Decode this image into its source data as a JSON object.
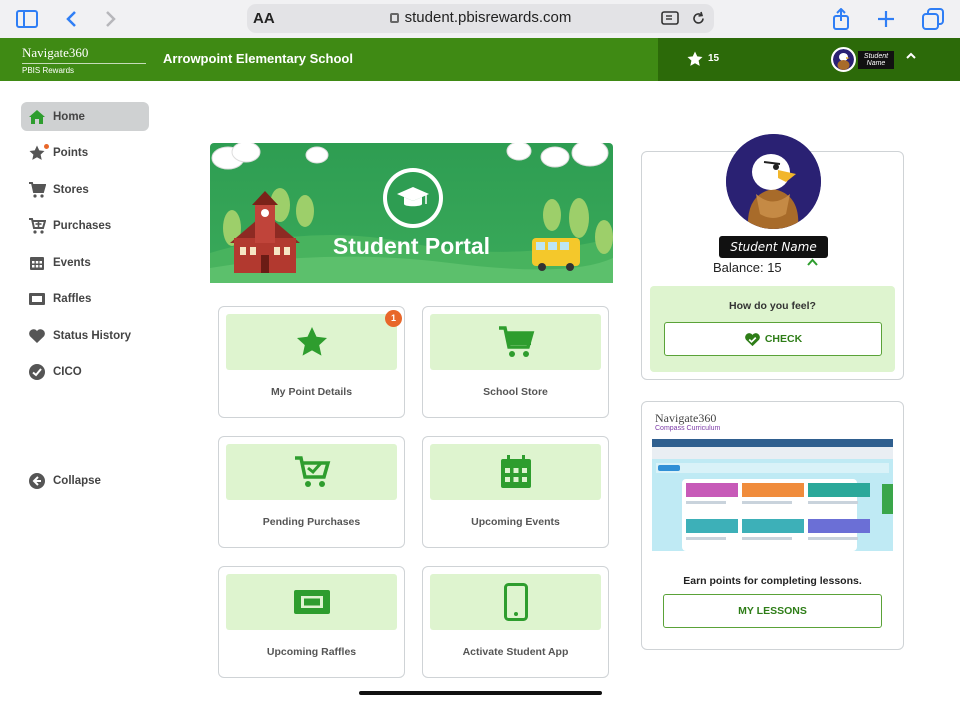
{
  "browser": {
    "url": "student.pbisrewards.com",
    "text_size_label": "AA"
  },
  "header": {
    "brand_main": "Navigate360",
    "brand_sub": "PBIS Rewards",
    "school_name": "Arrowpoint Elementary School",
    "points": "15",
    "user_name": "Student Name"
  },
  "sidebar": {
    "items": [
      {
        "label": "Home",
        "icon": "home-icon"
      },
      {
        "label": "Points",
        "icon": "star-icon"
      },
      {
        "label": "Stores",
        "icon": "cart-icon"
      },
      {
        "label": "Purchases",
        "icon": "cart-plus-icon"
      },
      {
        "label": "Events",
        "icon": "calendar-icon"
      },
      {
        "label": "Raffles",
        "icon": "ticket-icon"
      },
      {
        "label": "Status History",
        "icon": "heart-icon"
      },
      {
        "label": "CICO",
        "icon": "check-circle-icon"
      }
    ],
    "collapse_label": "Collapse"
  },
  "banner": {
    "title": "Student Portal"
  },
  "tiles": [
    {
      "label": "My Point Details",
      "icon": "star-icon",
      "badge": "1"
    },
    {
      "label": "School Store",
      "icon": "cart-icon"
    },
    {
      "label": "Pending Purchases",
      "icon": "cart-check-icon"
    },
    {
      "label": "Upcoming Events",
      "icon": "calendar-icon"
    },
    {
      "label": "Upcoming Raffles",
      "icon": "ticket-icon"
    },
    {
      "label": "Activate Student App",
      "icon": "phone-icon"
    }
  ],
  "profile": {
    "name": "Student Name",
    "balance": "Balance: 15",
    "feel_prompt": "How do you feel?",
    "check_label": "CHECK"
  },
  "lessons": {
    "brand": "Navigate360",
    "subtitle": "Compass Curriculum",
    "earn_text": "Earn points for completing lessons.",
    "button_label": "MY LESSONS"
  },
  "colors": {
    "header_green": "#3f8a14",
    "header_dark_green": "#2c6a09",
    "tile_bg": "#def4cf",
    "icon_green": "#2e9d2e",
    "badge_orange": "#e8672a"
  }
}
